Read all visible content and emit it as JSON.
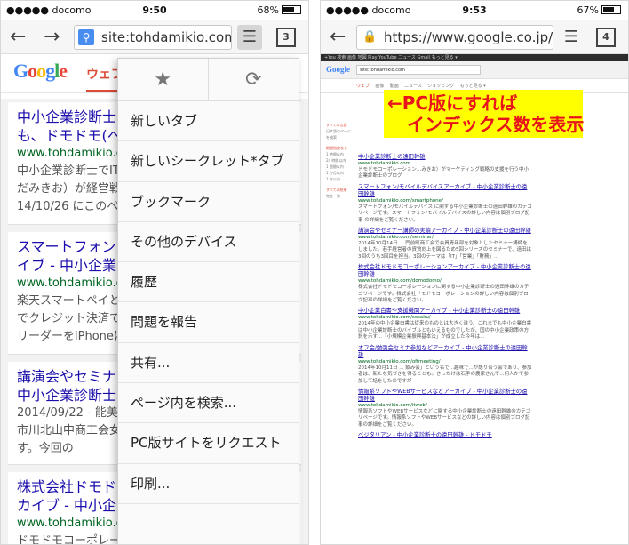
{
  "left": {
    "status": {
      "carrier": "●●●●● docomo",
      "time": "9:50",
      "battery": "68%",
      "battery_level": 0.68
    },
    "toolbar": {
      "url": "site:tohdamikio.com",
      "tabs_count": "3"
    },
    "google": {
      "logo": "Google",
      "tab_web": "ウェブ"
    },
    "results": [
      {
        "title": "中小企業診断士\nも、ドモドモ(ヘ",
        "url": "www.tohdamikio.com",
        "snippet": "中小企業診断士でIT\nだみきお）が経営戦略などの\n14/10/26 にこのペー"
      },
      {
        "title": "スマートフォン\nイブ - 中小企業",
        "url": "www.tohdamikio.com",
        "snippet": "楽天スマートペイと\nでクレジット決済で\nリーダーをiPhoneに"
      },
      {
        "title": "講演会やセミナー\n中小企業診断士",
        "url": "2014/09/22 - 能美市",
        "snippet": "市川北山中商工会女\nす。今回の"
      },
      {
        "title": "株式会社ドモドモコーポレーションアー\nカイブ - 中小企業診断士の遠田",
        "url": "www.tohdamikio.com/domodomo/",
        "snippet": "ドモドモコーポレーション公式サイトとPRサイトを"
      }
    ],
    "menu": {
      "items": [
        "新しいタブ",
        "新しいシークレット*タブ",
        "ブックマーク",
        "その他のデバイス",
        "履歴",
        "問題を報告",
        "共有...",
        "ページ内を検索...",
        "PC版サイトをリクエスト",
        "印刷..."
      ]
    }
  },
  "right": {
    "status": {
      "carrier": "●●●●● docomo",
      "time": "9:53",
      "battery": "67%",
      "battery_level": 0.67
    },
    "toolbar": {
      "url": "https://www.google.co.jp/se",
      "tabs_count": "4"
    },
    "mini": {
      "topbar": "+You 検索 画像 地図 Play YouTube ニュース Gmail もっと見る ▾",
      "logo": "Google",
      "query": "site:tohdamikio.com",
      "tabs": [
        "ウェブ",
        "画像",
        "動画",
        "ニュース",
        "ショッピング",
        "もっと見る ▾"
      ],
      "side_items": [
        "すべての言語",
        "日本語のページを検索",
        "期間指定なし",
        "1 時間以内",
        "24 時間以内",
        "1 週間以内",
        "1 か月以内",
        "1 年以内",
        "すべての結果",
        "完全一致"
      ],
      "results": [
        {
          "t": "中小企業診断士の遠田幹雄",
          "u": "www.tohdamikio.com",
          "s": "ドモドモコーポレーション…みきお）がマーケティング戦略の支援を行う中小企業診断士のブログ"
        },
        {
          "t": "スマートフォン/モバイルデバイスアーカイブ - 中小企業診断士の遠田幹雄",
          "u": "www.tohdamikio.com/smartphone/",
          "s": "スマートフォン/モバイルデバイス に関する中小企業診断士の遠田幹雄のカテゴリページです。スマートフォン/モバイルデバイスの詳しい内容は個別ブログ記事 の詳細をご覧ください。"
        },
        {
          "t": "講演会やセミナー講師の実績アーカイブ - 中小企業診断士の遠田幹雄",
          "u": "www.tohdamikio.com/seminar/",
          "s": "2014年10月14日 ... 門前町商工会で会員青年部を対象としたセミナー講師をしました。若手経営者の資質向上を図るため5回シリーズのセミナーで、遠田は3回のうち3回目を担当。3回のテーマは「IT」「営業」「財務」..."
        },
        {
          "t": "株式会社ドモドモコーポレーションアーカイブ - 中小企業診断士の遠田幹雄",
          "u": "www.tohdamikio.com/domodomo/",
          "s": "株式会社ドモドモコーポレーションに関する中小企業診断士の遠田幹雄のカテゴリページです。株式会社ドモドモコーポレーションの詳しい内容は個別ブログ記事の詳細をご覧ください。"
        },
        {
          "t": "中小企業白書や支援機関アーカイブ - 中小企業診断士の遠田幹雄",
          "u": "www.tohdamikio.com/sesaku/",
          "s": "2014年の中小企業白書は従来のものとは大きく違う。これまでも中小企業白書は中小企業診断士のバイブルともいえるものでしたが、国の中小企業政策の方針を示す...「小規模企業振興基本法」が成立した今年は..."
        },
        {
          "t": "オフ会/勉強会セミナ参加などアーカイブ - 中小企業診断士の遠田幹雄",
          "u": "www.tohdamikio.com/offmeeting/",
          "s": "2014年10月11日 ... 飲み会」という名で...趣味で...が語り合う会であり、参加者は、新たな気づきを得ることも。さっかけは石手の農家さんで...何人かで参加して話をしたのですが"
        },
        {
          "t": "情報系ソフトやWEBサービスなどアーカイブ - 中小企業診断士の遠田幹雄",
          "u": "www.tohdamikio.com/itweb/",
          "s": "情報系ソフトやWEBサービスなどに関する中小企業診断士の遠田幹雄のカテゴリページです。情報系ソフトやWEBサービスなどの詳しい内容は個別ブログ記事の詳細をご覧ください。"
        },
        {
          "t": "ベジタリアン - 中小企業診断士の遠田幹雄 - ドモドモ",
          "u": "",
          "s": ""
        }
      ]
    },
    "annotation": {
      "line1": "←PC版にすれば",
      "line2": "インデックス数を表示"
    }
  }
}
